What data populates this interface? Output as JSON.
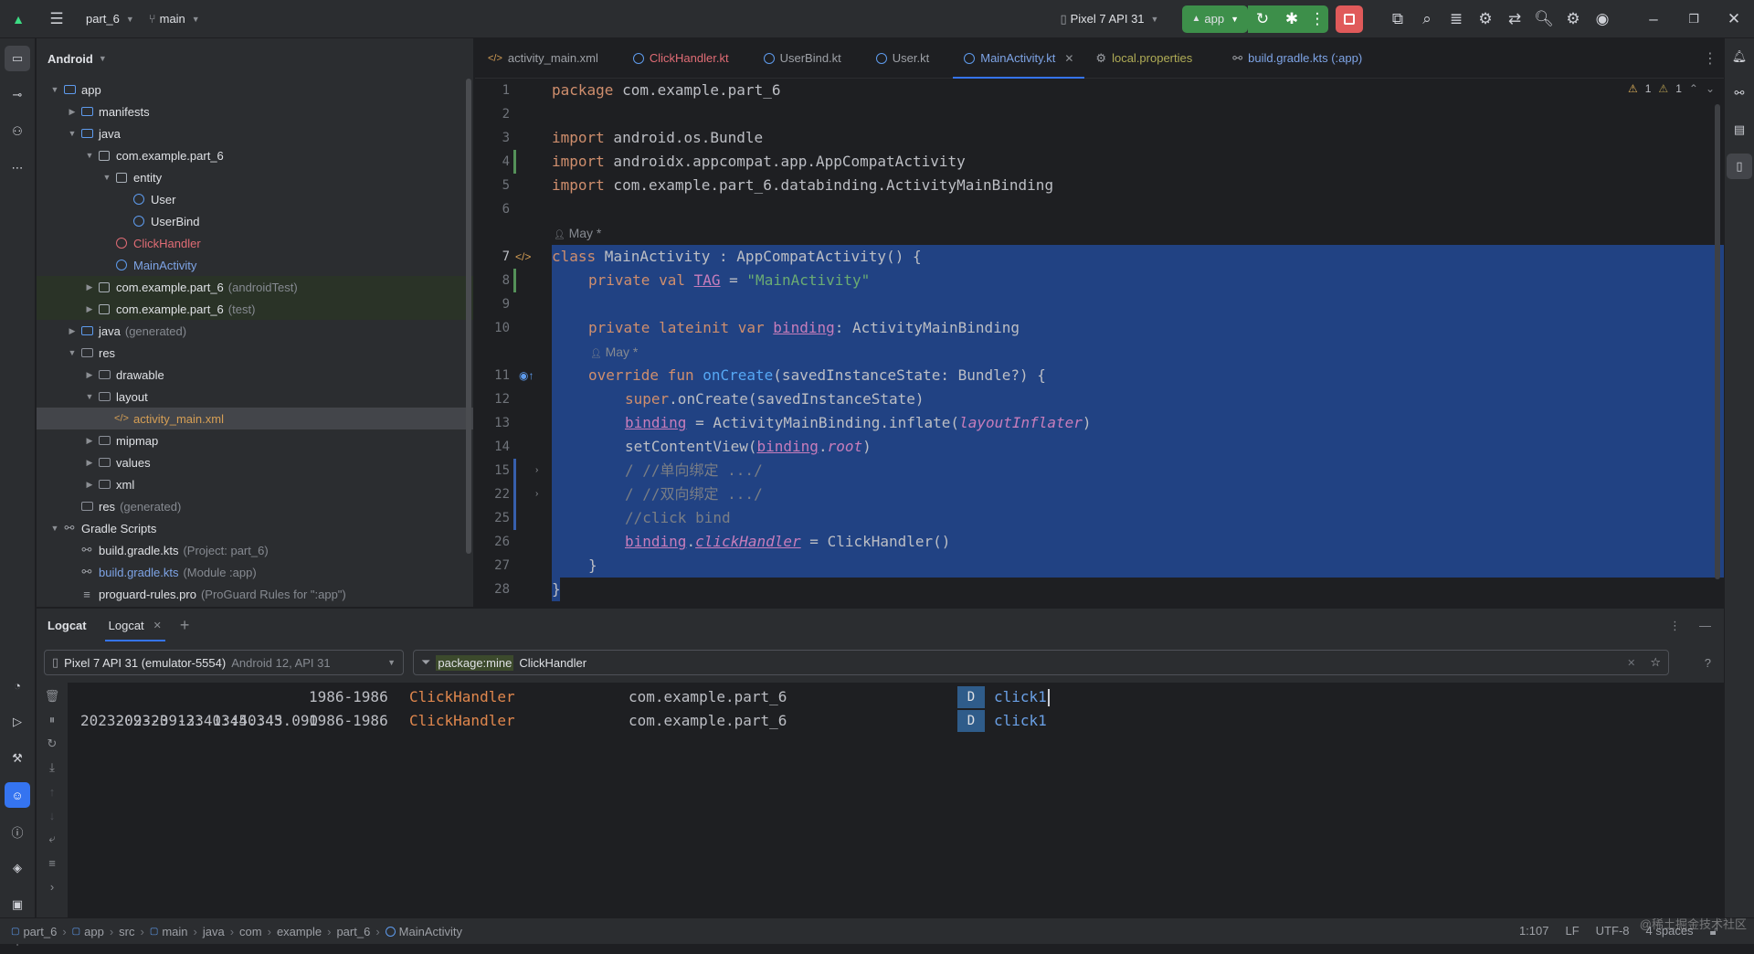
{
  "titlebar": {
    "project": "part_6",
    "branch": "main",
    "device": "Pixel 7 API 31",
    "run_config": "app"
  },
  "project_panel": {
    "view": "Android",
    "tree": [
      {
        "label": "app",
        "hint": ""
      },
      {
        "label": "manifests",
        "hint": ""
      },
      {
        "label": "java",
        "hint": ""
      },
      {
        "label": "com.example.part_6",
        "hint": ""
      },
      {
        "label": "entity",
        "hint": ""
      },
      {
        "label": "User",
        "hint": ""
      },
      {
        "label": "UserBind",
        "hint": ""
      },
      {
        "label": "ClickHandler",
        "hint": ""
      },
      {
        "label": "MainActivity",
        "hint": ""
      },
      {
        "label": "com.example.part_6",
        "hint": "(androidTest)"
      },
      {
        "label": "com.example.part_6",
        "hint": "(test)"
      },
      {
        "label": "java",
        "hint": "(generated)"
      },
      {
        "label": "res",
        "hint": ""
      },
      {
        "label": "drawable",
        "hint": ""
      },
      {
        "label": "layout",
        "hint": ""
      },
      {
        "label": "activity_main.xml",
        "hint": ""
      },
      {
        "label": "mipmap",
        "hint": ""
      },
      {
        "label": "values",
        "hint": ""
      },
      {
        "label": "xml",
        "hint": ""
      },
      {
        "label": "res",
        "hint": "(generated)"
      },
      {
        "label": "Gradle Scripts",
        "hint": ""
      },
      {
        "label": "build.gradle.kts",
        "hint": "(Project: part_6)"
      },
      {
        "label": "build.gradle.kts",
        "hint": "(Module :app)"
      },
      {
        "label": "proguard-rules.pro",
        "hint": "(ProGuard Rules for \":app\")"
      }
    ]
  },
  "editor_tabs": [
    {
      "label": "activity_main.xml"
    },
    {
      "label": "ClickHandler.kt"
    },
    {
      "label": "UserBind.kt"
    },
    {
      "label": "User.kt"
    },
    {
      "label": "MainActivity.kt"
    },
    {
      "label": "local.properties"
    },
    {
      "label": "build.gradle.kts (:app)"
    }
  ],
  "inspections": {
    "warnings": "1",
    "weak_warnings": "1"
  },
  "code": {
    "line_numbers": [
      "1",
      "2",
      "3",
      "4",
      "5",
      "6",
      "7",
      "8",
      "9",
      "10",
      "11",
      "12",
      "13",
      "14",
      "15",
      "22",
      "25",
      "26",
      "27",
      "28"
    ],
    "l1_kw": "package",
    "l1_rest": " com.example.part_6",
    "l3_kw": "import",
    "l3_rest": " android.os.Bundle",
    "l4_kw": "import",
    "l4_rest": " androidx.appcompat.app.AppCompatActivity",
    "l5_kw": "import",
    "l5_rest": " com.example.part_6.databinding.ActivityMainBinding",
    "author_hint": "May *",
    "l7_kw": "class",
    "l7_rest": " MainActivity : AppCompatActivity() {",
    "l8_kw": "private val",
    "l8_tag": "TAG",
    "l8_eq": " = ",
    "l8_str": "\"MainActivity\"",
    "l10_kw": "private lateinit var",
    "l10_var": "binding",
    "l10_rest": ": ActivityMainBinding",
    "l11_kw": "override fun",
    "l11_fn": "onCreate",
    "l11_rest": "(savedInstanceState: Bundle?) {",
    "l12_kw": "super",
    "l12_rest": ".onCreate(savedInstanceState)",
    "l13_var": "binding",
    "l13_rest": " = ActivityMainBinding.inflate(",
    "l13_prop": "layoutInflater",
    "l13_end": ")",
    "l14_a": "setContentView(",
    "l14_var": "binding",
    "l14_dot": ".",
    "l14_prop": "root",
    "l14_end": ")",
    "l15_cm": "/ //单向绑定 .../",
    "l22_cm": "/ //双向绑定 .../",
    "l25_cm": "//click bind",
    "l26_var": "binding",
    "l26_dot": ".",
    "l26_prop": "clickHandler",
    "l26_rest": " = ClickHandler()",
    "l27": "}",
    "l28": "}"
  },
  "logcat": {
    "tabs": [
      "Logcat",
      "Logcat"
    ],
    "device": "Pixel 7 API 31 (emulator-5554)",
    "device_hint": "Android 12, API 31",
    "filter_key": "package:mine",
    "filter_rest": "ClickHandler",
    "rows": [
      {
        "time": "2023-09-23 13:40:45.090",
        "pid": "1986-1986",
        "tag": "ClickHandler",
        "pkg": "com.example.part_6",
        "level": "D",
        "msg": "click1"
      },
      {
        "time": "2023-09-23 13:40:45.343",
        "pid": "1986-1986",
        "tag": "ClickHandler",
        "pkg": "com.example.part_6",
        "level": "D",
        "msg": "click1"
      }
    ]
  },
  "statusbar": {
    "breadcrumbs": [
      "part_6",
      "app",
      "src",
      "main",
      "java",
      "com",
      "example",
      "part_6",
      "MainActivity"
    ],
    "position": "1:107",
    "line_sep": "LF",
    "encoding": "UTF-8",
    "indent": "4 spaces",
    "watermark": "@稀土掘金技术社区"
  },
  "colors": {
    "accent": "#3574f0",
    "selection": "#214283",
    "run_green": "#3d8f4a",
    "stop_red": "#e05a5a"
  }
}
